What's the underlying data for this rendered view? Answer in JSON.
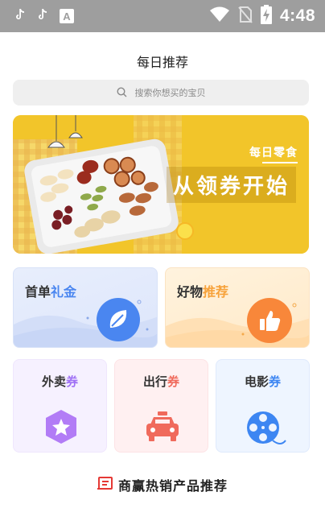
{
  "status_bar": {
    "time": "4:48",
    "icons": [
      "tiktok-icon",
      "tiktok-icon",
      "a-icon",
      "wifi-icon",
      "no-sim-icon",
      "battery-charging-icon"
    ],
    "a_icon_letter": "A"
  },
  "page": {
    "title": "每日推荐"
  },
  "search": {
    "placeholder": "搜索你想买的宝贝"
  },
  "banner": {
    "subtitle": "每日零食",
    "headline": "从领券开始"
  },
  "cards_large": [
    {
      "prefix": "首单",
      "accent": "礼金",
      "accent_color": "#4a86f0"
    },
    {
      "prefix": "好物",
      "accent": "推荐",
      "accent_color": "#f7a23a"
    }
  ],
  "cards_small": [
    {
      "prefix": "外卖",
      "accent": "券",
      "accent_color": "#a072f5"
    },
    {
      "prefix": "出行",
      "accent": "券",
      "accent_color": "#f06a5c"
    },
    {
      "prefix": "电影",
      "accent": "券",
      "accent_color": "#3d86f2"
    }
  ],
  "section": {
    "heading": "商赢热销产品推荐"
  },
  "colors": {
    "status_bar": "#9e9e9e",
    "banner_yellow": "#f2c52a"
  }
}
